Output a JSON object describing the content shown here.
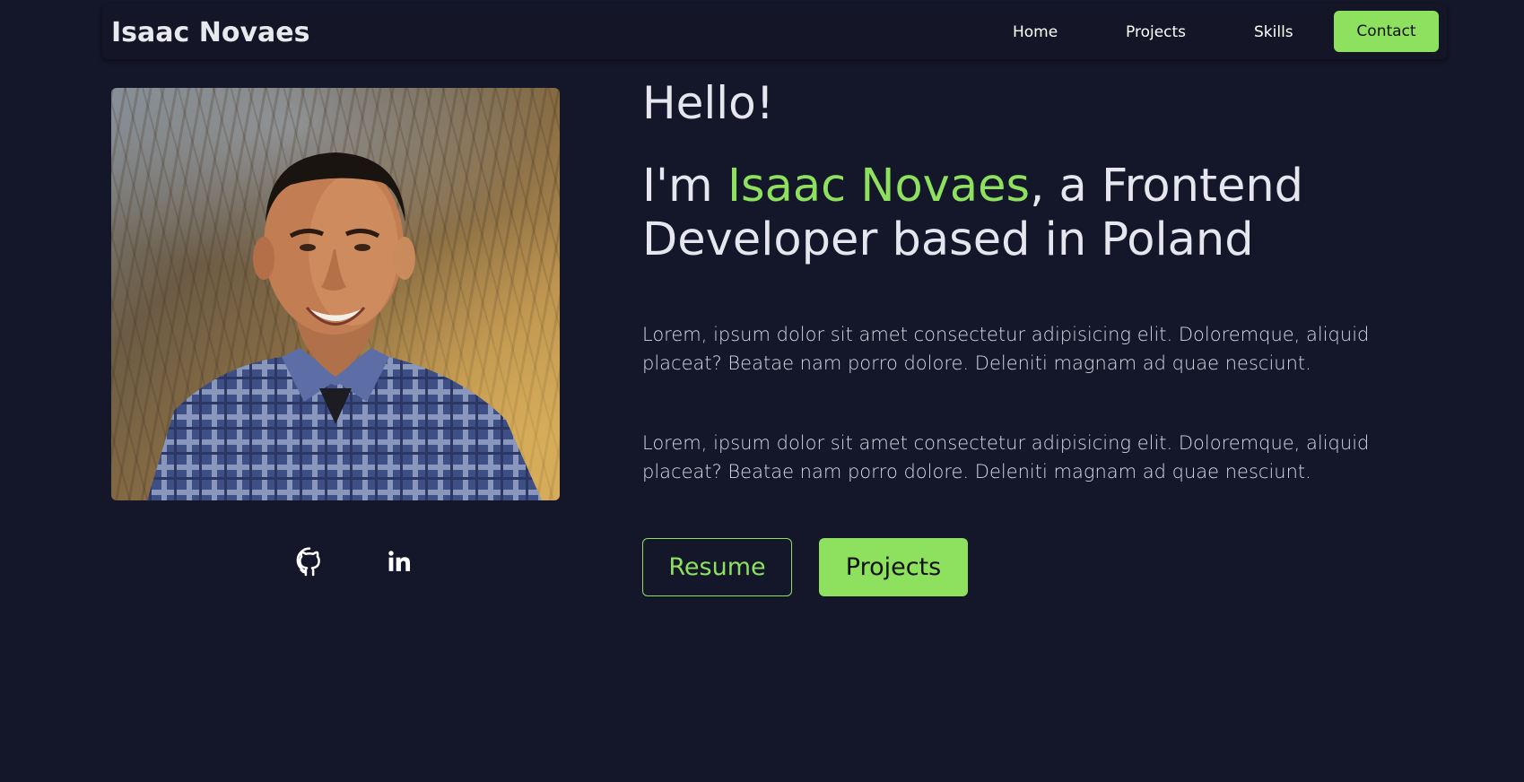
{
  "nav": {
    "brand": "Isaac Novaes",
    "links": [
      "Home",
      "Projects",
      "Skills"
    ],
    "contact_label": "Contact"
  },
  "hero": {
    "greeting": "Hello!",
    "intro_prefix": "I'm ",
    "name": "Isaac Novaes",
    "intro_suffix": ", a Frontend Developer based in Poland",
    "paragraphs": [
      "Lorem, ipsum dolor sit amet consectetur adipisicing elit. Doloremque, aliquid placeat? Beatae nam porro dolore. Deleniti magnam ad quae nesciunt.",
      "Lorem, ipsum dolor sit amet consectetur adipisicing elit. Doloremque, aliquid placeat? Beatae nam porro dolore. Deleniti magnam ad quae nesciunt."
    ],
    "resume_label": "Resume",
    "projects_label": "Projects"
  },
  "social": {
    "icons": [
      "github-icon",
      "linkedin-icon"
    ]
  },
  "colors": {
    "background": "#14162a",
    "accent": "#8ee05f",
    "text": "#e6e6ee"
  }
}
